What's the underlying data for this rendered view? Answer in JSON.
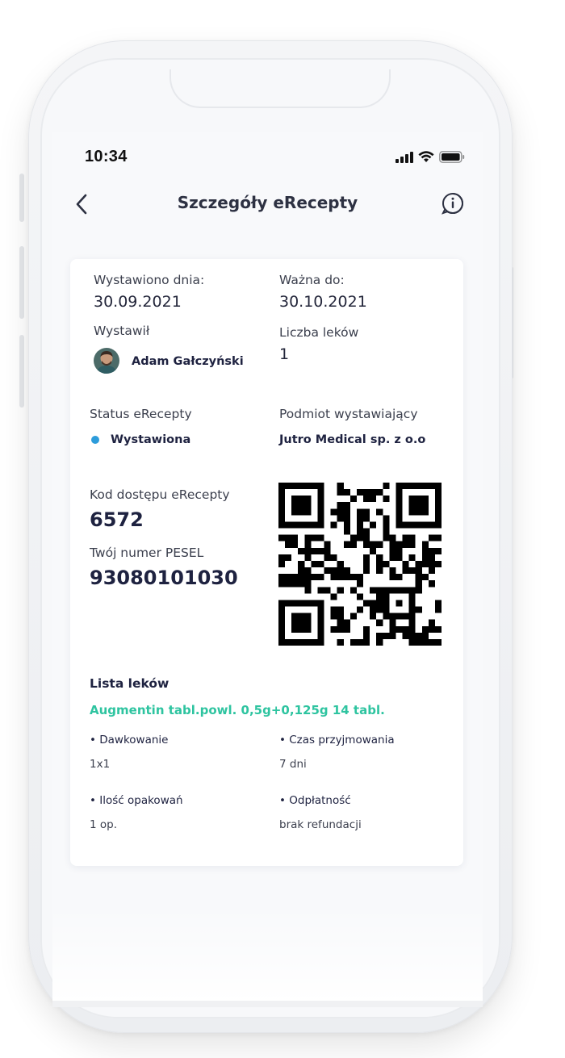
{
  "status_bar": {
    "time": "10:34",
    "icons": [
      "cellular-signal-icon",
      "wifi-icon",
      "battery-icon"
    ]
  },
  "header": {
    "title": "Szczegóły eRecepty",
    "back_icon": "chevron-left-icon",
    "info_icon": "info-bubble-icon"
  },
  "prescription": {
    "issued_date_label": "Wystawiono dnia:",
    "issued_date": "30.09.2021",
    "valid_until_label": "Ważna do:",
    "valid_until": "30.10.2021",
    "issuer_label": "Wystawił",
    "issuer_name": "Adam Gałczyński",
    "med_count_label": "Liczba leków",
    "med_count": "1",
    "status_label": "Status eRecepty",
    "status_value": "Wystawiona",
    "entity_label": "Podmiot wystawiający",
    "entity_value": "Jutro  Medical sp. z o.o",
    "access_code_label": "Kod dostępu eRecepty",
    "access_code": "6572",
    "pesel_label": "Twój numer PESEL",
    "pesel": "93080101030"
  },
  "medications": {
    "section_title": "Lista leków",
    "items": [
      {
        "name": "Augmentin tabl.powl. 0,5g+0,125g 14 tabl.",
        "dosage_label": "• Dawkowanie",
        "dosage": "1x1",
        "duration_label": "• Czas przyjmowania",
        "duration": "7 dni",
        "packages_label": "• Ilość opakowań",
        "packages": "1 op.",
        "payment_label": "• Odpłatność",
        "payment": "brak refundacji"
      }
    ]
  },
  "colors": {
    "accent_green": "#2ec4a0",
    "status_blue": "#2d9cdb",
    "text_dark": "#1e2240",
    "background": "#f8f9fb"
  }
}
